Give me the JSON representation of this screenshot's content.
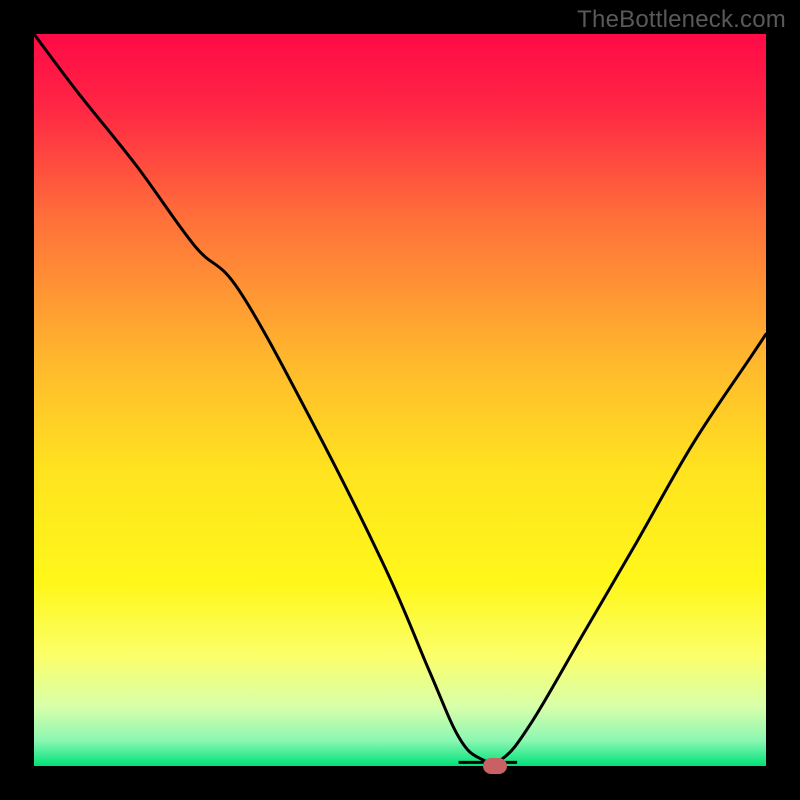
{
  "watermark": "TheBottleneck.com",
  "chart_data": {
    "type": "line",
    "title": "",
    "xlabel": "",
    "ylabel": "",
    "xlim": [
      0,
      100
    ],
    "ylim": [
      0,
      100
    ],
    "grid": false,
    "legend": false,
    "background": {
      "type": "vertical-gradient",
      "stops": [
        {
          "pos": 0.0,
          "color": "#ff0a47"
        },
        {
          "pos": 0.1,
          "color": "#ff2644"
        },
        {
          "pos": 0.25,
          "color": "#ff6f3a"
        },
        {
          "pos": 0.45,
          "color": "#ffb92d"
        },
        {
          "pos": 0.6,
          "color": "#ffe41f"
        },
        {
          "pos": 0.75,
          "color": "#fff71a"
        },
        {
          "pos": 0.85,
          "color": "#fbff6a"
        },
        {
          "pos": 0.92,
          "color": "#d7ffab"
        },
        {
          "pos": 0.965,
          "color": "#8cf7b2"
        },
        {
          "pos": 1.0,
          "color": "#00e279"
        }
      ]
    },
    "series": [
      {
        "name": "bottleneck-curve",
        "x": [
          0,
          6,
          14,
          22,
          28,
          38,
          48,
          54,
          58,
          61,
          64,
          68,
          75,
          82,
          90,
          98,
          100
        ],
        "y": [
          100,
          92,
          82,
          71,
          65,
          47,
          27,
          13,
          4,
          1,
          1,
          6,
          18,
          30,
          44,
          56,
          59
        ]
      }
    ],
    "marker": {
      "x": 63,
      "y": 0,
      "color": "#c86164"
    },
    "flat_segment": {
      "x_start": 58,
      "x_end": 66,
      "y": 0.5
    }
  }
}
